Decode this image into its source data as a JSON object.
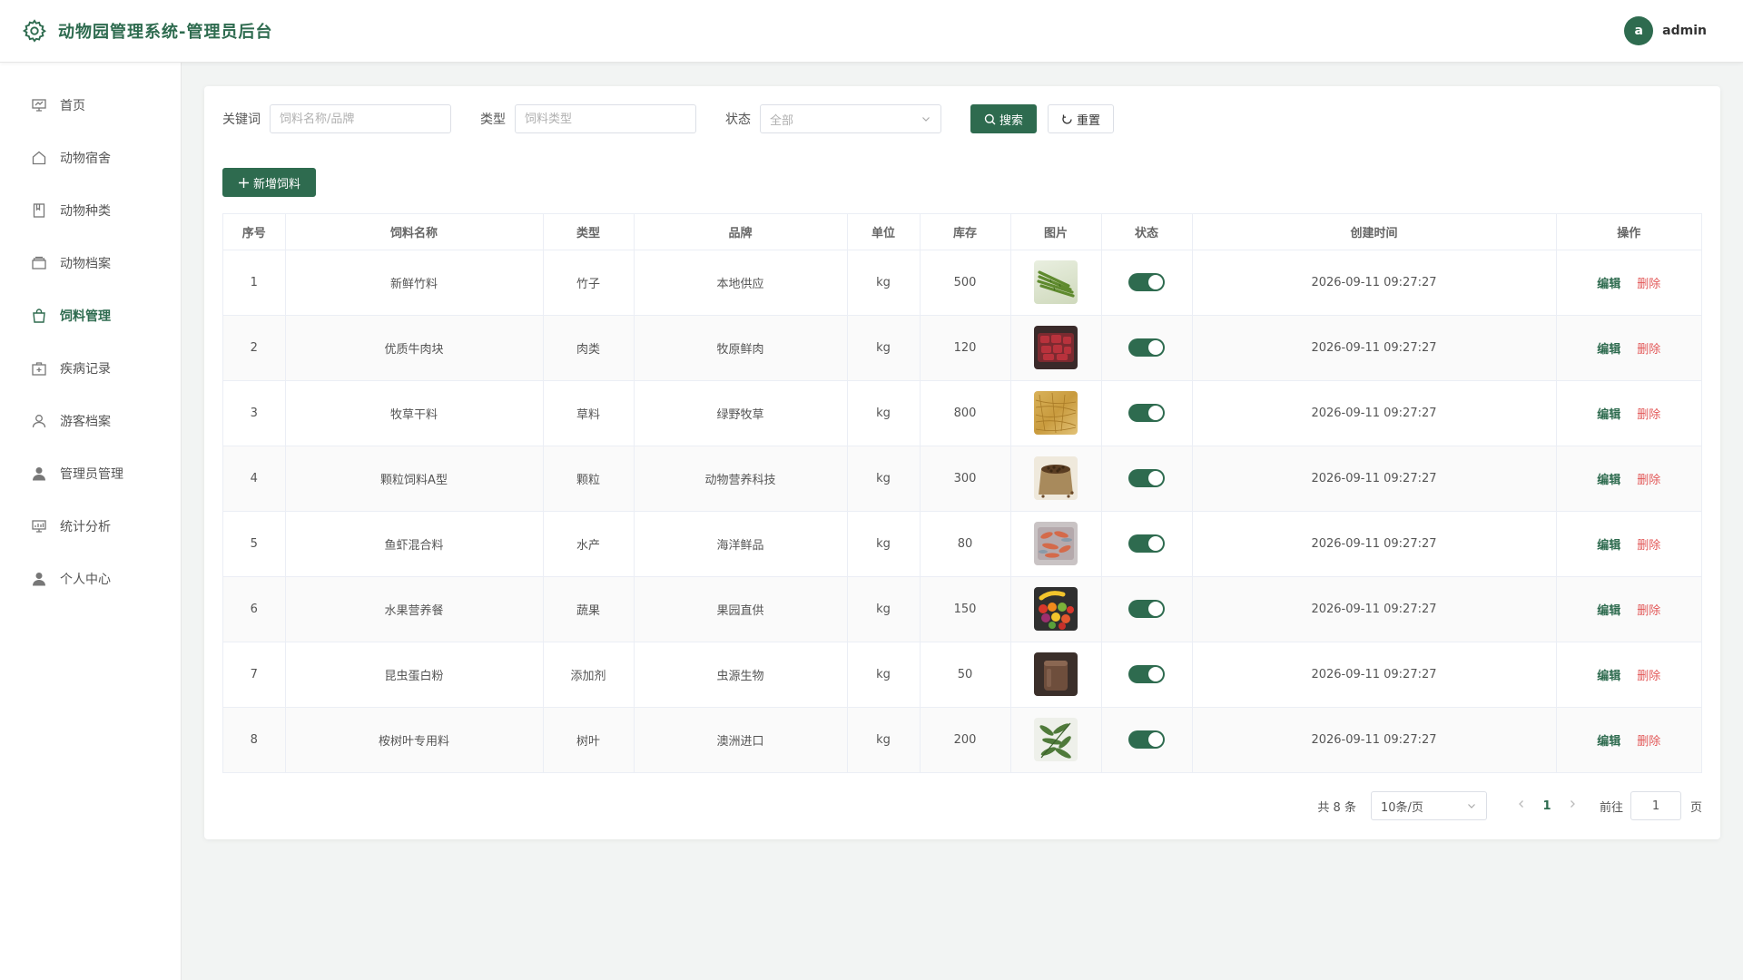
{
  "header": {
    "title": "动物园管理系统-管理员后台",
    "avatar_letter": "a",
    "username": "admin"
  },
  "sidebar": {
    "items": [
      {
        "label": "首页",
        "icon": "dashboard-icon"
      },
      {
        "label": "动物宿舍",
        "icon": "home-icon"
      },
      {
        "label": "动物种类",
        "icon": "book-icon"
      },
      {
        "label": "动物档案",
        "icon": "box-icon"
      },
      {
        "label": "饲料管理",
        "icon": "bag-icon",
        "active": true
      },
      {
        "label": "疾病记录",
        "icon": "medical-kit-icon"
      },
      {
        "label": "游客档案",
        "icon": "user-outline-icon"
      },
      {
        "label": "管理员管理",
        "icon": "user-filled-icon"
      },
      {
        "label": "统计分析",
        "icon": "chart-board-icon"
      },
      {
        "label": "个人中心",
        "icon": "user-filled-icon"
      }
    ]
  },
  "filters": {
    "keyword_label": "关键词",
    "keyword_placeholder": "饲料名称/品牌",
    "type_label": "类型",
    "type_placeholder": "饲料类型",
    "status_label": "状态",
    "status_value": "全部",
    "search_label": "搜索",
    "reset_label": "重置"
  },
  "add_button": "新增饲料",
  "table": {
    "columns": [
      "序号",
      "饲料名称",
      "类型",
      "品牌",
      "单位",
      "库存",
      "图片",
      "状态",
      "创建时间",
      "操作"
    ],
    "edit_label": "编辑",
    "delete_label": "删除",
    "rows": [
      {
        "no": "1",
        "name": "新鲜竹料",
        "type": "竹子",
        "brand": "本地供应",
        "unit": "kg",
        "stock": "500",
        "image": "bamboo-photo",
        "status": true,
        "created": "2026-09-11 09:27:27"
      },
      {
        "no": "2",
        "name": "优质牛肉块",
        "type": "肉类",
        "brand": "牧原鲜肉",
        "unit": "kg",
        "stock": "120",
        "image": "beef-photo",
        "status": true,
        "created": "2026-09-11 09:27:27"
      },
      {
        "no": "3",
        "name": "牧草干料",
        "type": "草料",
        "brand": "绿野牧草",
        "unit": "kg",
        "stock": "800",
        "image": "hay-photo",
        "status": true,
        "created": "2026-09-11 09:27:27"
      },
      {
        "no": "4",
        "name": "颗粒饲料A型",
        "type": "颗粒",
        "brand": "动物营养科技",
        "unit": "kg",
        "stock": "300",
        "image": "pellets-photo",
        "status": true,
        "created": "2026-09-11 09:27:27"
      },
      {
        "no": "5",
        "name": "鱼虾混合料",
        "type": "水产",
        "brand": "海洋鲜品",
        "unit": "kg",
        "stock": "80",
        "image": "seafood-photo",
        "status": true,
        "created": "2026-09-11 09:27:27"
      },
      {
        "no": "6",
        "name": "水果营养餐",
        "type": "蔬果",
        "brand": "果园直供",
        "unit": "kg",
        "stock": "150",
        "image": "fruit-photo",
        "status": true,
        "created": "2026-09-11 09:27:27"
      },
      {
        "no": "7",
        "name": "昆虫蛋白粉",
        "type": "添加剂",
        "brand": "虫源生物",
        "unit": "kg",
        "stock": "50",
        "image": "protein-powder-photo",
        "status": true,
        "created": "2026-09-11 09:27:27"
      },
      {
        "no": "8",
        "name": "桉树叶专用料",
        "type": "树叶",
        "brand": "澳洲进口",
        "unit": "kg",
        "stock": "200",
        "image": "eucalyptus-photo",
        "status": true,
        "created": "2026-09-11 09:27:27"
      }
    ]
  },
  "pagination": {
    "total": "共 8 条",
    "page_size": "10条/页",
    "current_page": "1",
    "goto_label": "前往",
    "goto_value": "1",
    "page_suffix": "页"
  },
  "colors": {
    "primary": "#2e6b4f",
    "danger": "#e25757"
  }
}
